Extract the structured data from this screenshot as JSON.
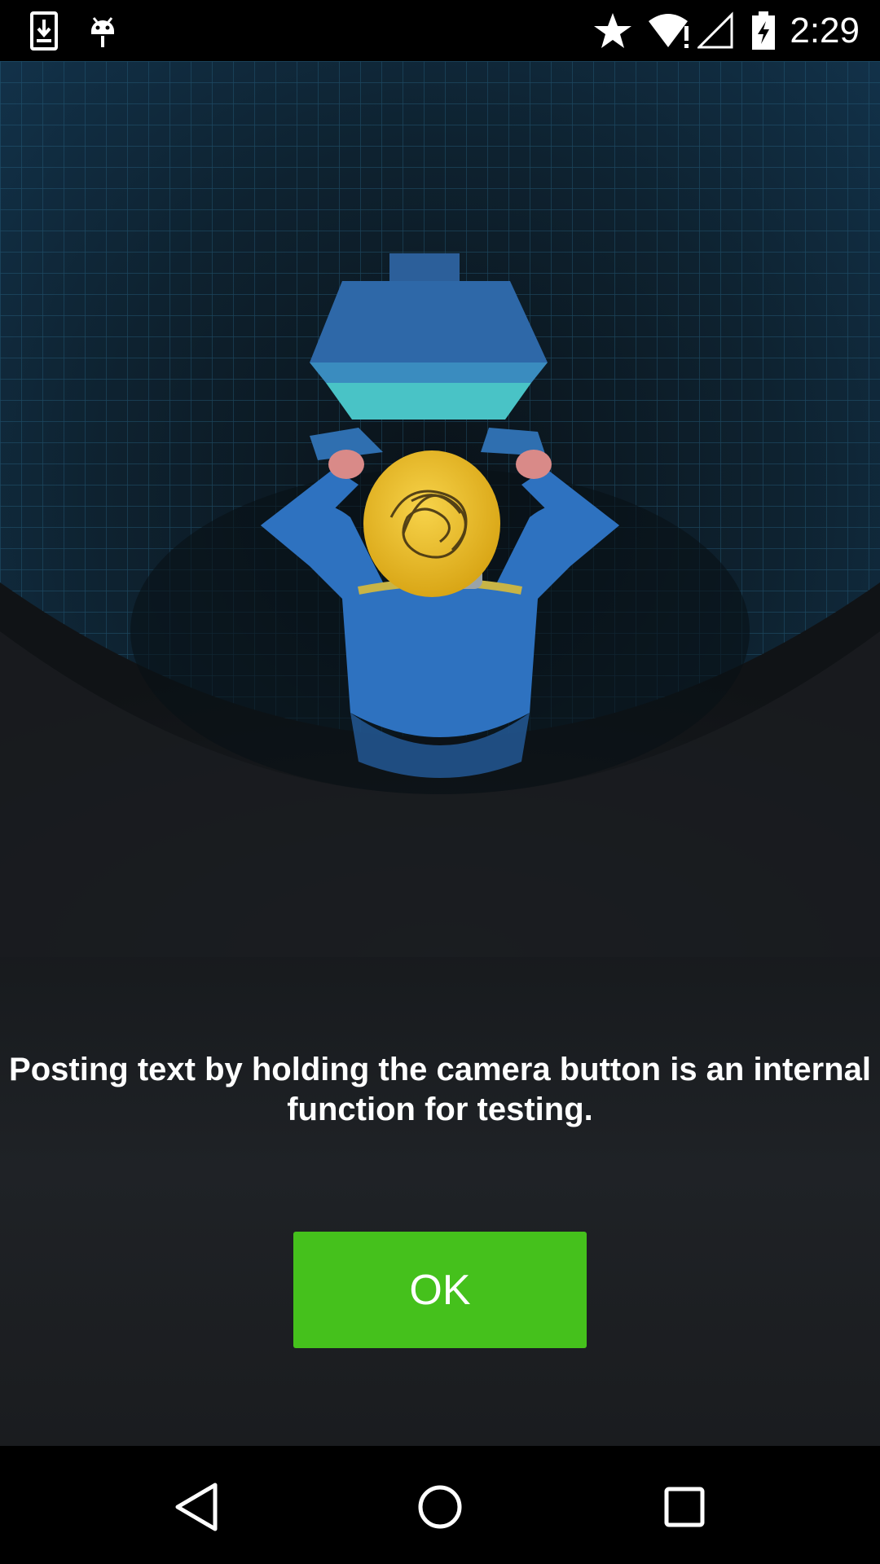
{
  "status_bar": {
    "time": "2:29",
    "icons": [
      "download-icon",
      "android-debug-icon",
      "star-icon",
      "wifi-alert-icon",
      "signal-icon",
      "battery-charging-icon"
    ]
  },
  "dialog": {
    "illustration": "person-with-lightbulb-head-illustration",
    "message": "Posting text by holding the camera button is an internal function for testing.",
    "ok_label": "OK"
  },
  "colors": {
    "accent": "#45c11c",
    "background": "#1a1c1f"
  },
  "nav_bar": {
    "buttons": [
      "back-icon",
      "home-icon",
      "recents-icon"
    ]
  }
}
